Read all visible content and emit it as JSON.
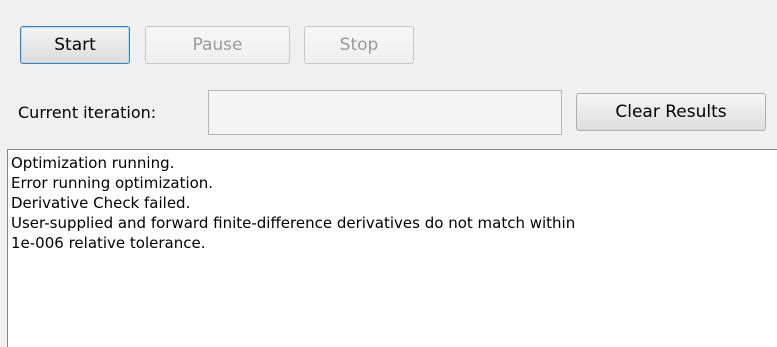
{
  "controls": {
    "start_label": "Start",
    "pause_label": "Pause",
    "stop_label": "Stop",
    "current_iteration_label": "Current iteration:",
    "current_iteration_value": "",
    "clear_results_label": "Clear Results"
  },
  "output": {
    "lines": [
      "Optimization running.",
      "Error running optimization.",
      "Derivative Check failed.",
      "User-supplied and forward finite-difference derivatives do not match within",
      "1e-006 relative tolerance."
    ]
  }
}
